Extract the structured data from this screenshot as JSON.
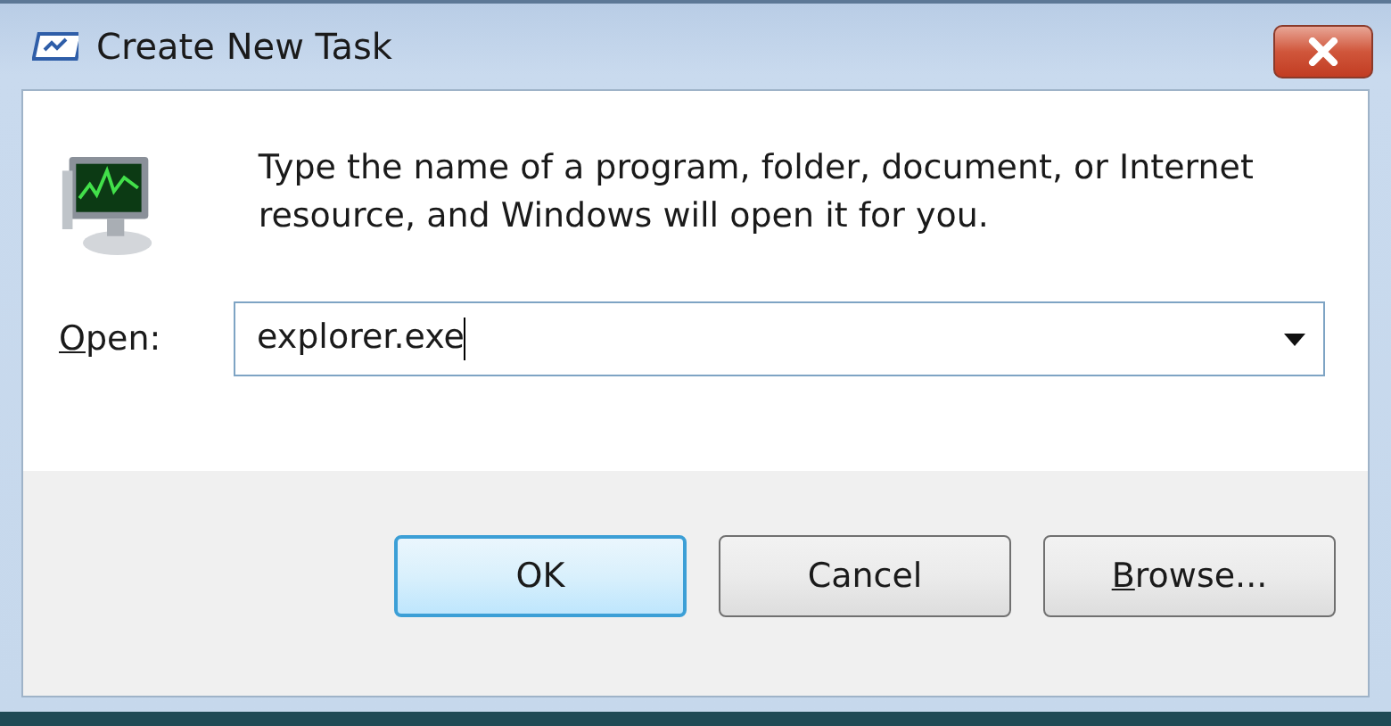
{
  "window": {
    "title": "Create New Task"
  },
  "message": "Type the name of a program, folder, document, or Internet resource, and Windows will open it for you.",
  "open_field": {
    "label": "Open:",
    "access_key_underlined": true,
    "value": "explorer.exe",
    "focused": true
  },
  "buttons": [
    {
      "label": "OK",
      "default": true,
      "access_key_underlined": false
    },
    {
      "label": "Cancel",
      "default": false,
      "access_key_underlined": false
    },
    {
      "label": "Browse...",
      "default": false,
      "access_key_underlined": true
    }
  ]
}
